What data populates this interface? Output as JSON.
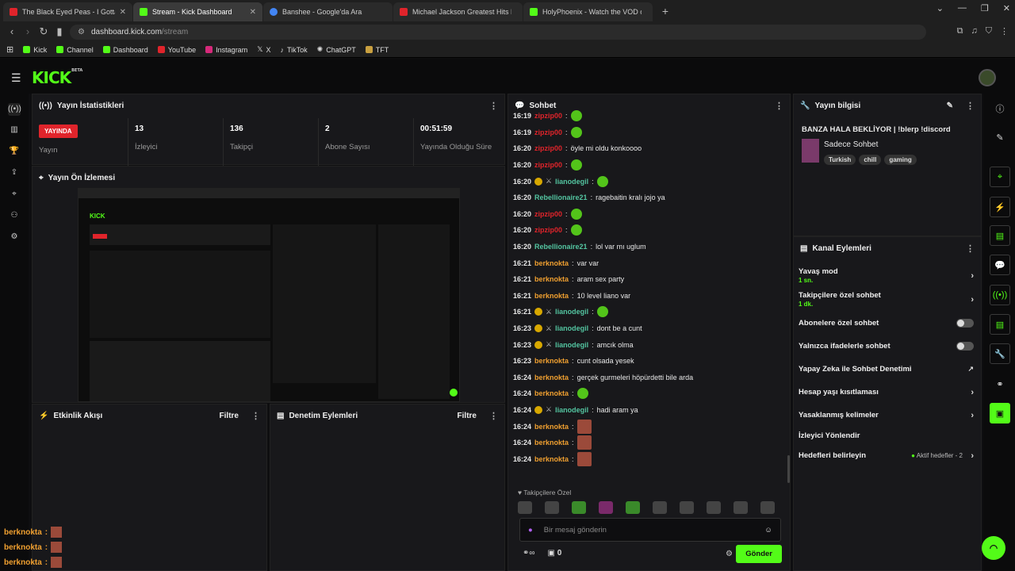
{
  "tabs": [
    {
      "label": "The Black Eyed Peas - I Gotta Feeling",
      "fav": "#e0242b"
    },
    {
      "label": "Stream - Kick Dashboard",
      "fav": "#53fc18"
    },
    {
      "label": "Banshee - Google'da Ara",
      "fav": "#4285f4"
    },
    {
      "label": "Michael Jackson Greatest Hits Ful",
      "fav": "#e0242b"
    },
    {
      "label": "HolyPhoenix - Watch the VOD on Ki",
      "fav": "#53fc18"
    }
  ],
  "url": {
    "host": "dashboard.kick.com",
    "path": "/stream"
  },
  "bookmarks": [
    "Kick",
    "Channel",
    "Dashboard",
    "YouTube",
    "Instagram",
    "X",
    "TikTok",
    "ChatGPT",
    "TFT"
  ],
  "logo": "KICK",
  "logo_sup": "BETA",
  "stats": {
    "title": "Yayın İstatistikleri",
    "live_badge": "YAYINDA",
    "live_label": "Yayın",
    "viewers": "13",
    "viewers_label": "İzleyici",
    "followers": "136",
    "followers_label": "Takipçi",
    "subs": "2",
    "subs_label": "Abone Sayısı",
    "uptime": "00:51:59",
    "uptime_label": "Yayında Olduğu Süre"
  },
  "preview_title": "Yayın Ön İzlemesi",
  "activity": {
    "title": "Etkinlik Akışı",
    "filter": "Filtre"
  },
  "moderation": {
    "title": "Denetim Eylemleri",
    "filter": "Filtre"
  },
  "chat": {
    "title": "Sohbet",
    "messages": [
      {
        "t": "16:19",
        "u": "zipzip00",
        "c": "#e0242b",
        "m": "",
        "e": true
      },
      {
        "t": "16:19",
        "u": "zipzip00",
        "c": "#e0242b",
        "m": "",
        "e": true
      },
      {
        "t": "16:20",
        "u": "zipzip00",
        "c": "#e0242b",
        "m": "öyle mi oldu konkoooo",
        "e": false
      },
      {
        "t": "16:20",
        "u": "zipzip00",
        "c": "#e0242b",
        "m": "",
        "e": true
      },
      {
        "t": "16:20",
        "u": "lianodegil",
        "c": "#53c4a0",
        "m": "",
        "e": true,
        "b": true
      },
      {
        "t": "16:20",
        "u": "Rebellionaire21",
        "c": "#53c4a0",
        "m": "ragebaitin kralı jojo ya",
        "e": false
      },
      {
        "t": "16:20",
        "u": "zipzip00",
        "c": "#e0242b",
        "m": "",
        "e": true
      },
      {
        "t": "16:20",
        "u": "zipzip00",
        "c": "#e0242b",
        "m": "",
        "e": true
      },
      {
        "t": "16:20",
        "u": "Rebellionaire21",
        "c": "#53c4a0",
        "m": "lol var mı uglum",
        "e": false
      },
      {
        "t": "16:21",
        "u": "berknokta",
        "c": "#f0a030",
        "m": "var var",
        "e": false
      },
      {
        "t": "16:21",
        "u": "berknokta",
        "c": "#f0a030",
        "m": "aram sex party",
        "e": false
      },
      {
        "t": "16:21",
        "u": "berknokta",
        "c": "#f0a030",
        "m": "10 level liano var",
        "e": false
      },
      {
        "t": "16:21",
        "u": "lianodegil",
        "c": "#53c4a0",
        "m": "",
        "e": true,
        "b": true
      },
      {
        "t": "16:23",
        "u": "lianodegil",
        "c": "#53c4a0",
        "m": "dont be a cunt",
        "e": false,
        "b": true
      },
      {
        "t": "16:23",
        "u": "lianodegil",
        "c": "#53c4a0",
        "m": "amcık olma",
        "e": false,
        "b": true
      },
      {
        "t": "16:23",
        "u": "berknokta",
        "c": "#f0a030",
        "m": "cunt olsada yesek",
        "e": false
      },
      {
        "t": "16:24",
        "u": "berknokta",
        "c": "#f0a030",
        "m": "gerçek gurmeleri höpürdetti bile arda",
        "e": false
      },
      {
        "t": "16:24",
        "u": "berknokta",
        "c": "#f0a030",
        "m": "",
        "e": true
      },
      {
        "t": "16:24",
        "u": "lianodegil",
        "c": "#53c4a0",
        "m": "hadi aram ya",
        "e": false,
        "b": true
      },
      {
        "t": "16:24",
        "u": "berknokta",
        "c": "#f0a030",
        "m": "",
        "e": true,
        "sq": true
      },
      {
        "t": "16:24",
        "u": "berknokta",
        "c": "#f0a030",
        "m": "",
        "e": true,
        "sq": true
      },
      {
        "t": "16:24",
        "u": "berknokta",
        "c": "#f0a030",
        "m": "",
        "e": true,
        "sq": true
      }
    ],
    "emote_section": "Takipçilere Özel",
    "placeholder": "Bir mesaj gönderin",
    "count": "0",
    "send": "Gönder"
  },
  "info": {
    "title": "Yayın bilgisi",
    "stream_title": "BANZA HALA BEKLİYOR | !blerp !discord",
    "category": "Sadece Sohbet",
    "tags": [
      "Turkish",
      "chill",
      "gaming"
    ]
  },
  "actions": {
    "title": "Kanal Eylemleri",
    "slow": "Yavaş mod",
    "slow_sub": "1 sn.",
    "followers": "Takipçilere özel sohbet",
    "followers_sub": "1 dk.",
    "subs": "Abonelere özel sohbet",
    "emotes": "Yalnızca ifadelerle sohbet",
    "ai": "Yapay Zeka ile Sohbet Denetimi",
    "age": "Hesap yaşı kısıtlaması",
    "banned": "Yasaklanmış kelimeler",
    "redirect": "İzleyici Yönlendir",
    "goals": "Hedefleri belirleyin",
    "goals_status": "Aktif hedefler - 2"
  },
  "overlay_chat": [
    "berknokta",
    "berknokta",
    "berknokta"
  ]
}
